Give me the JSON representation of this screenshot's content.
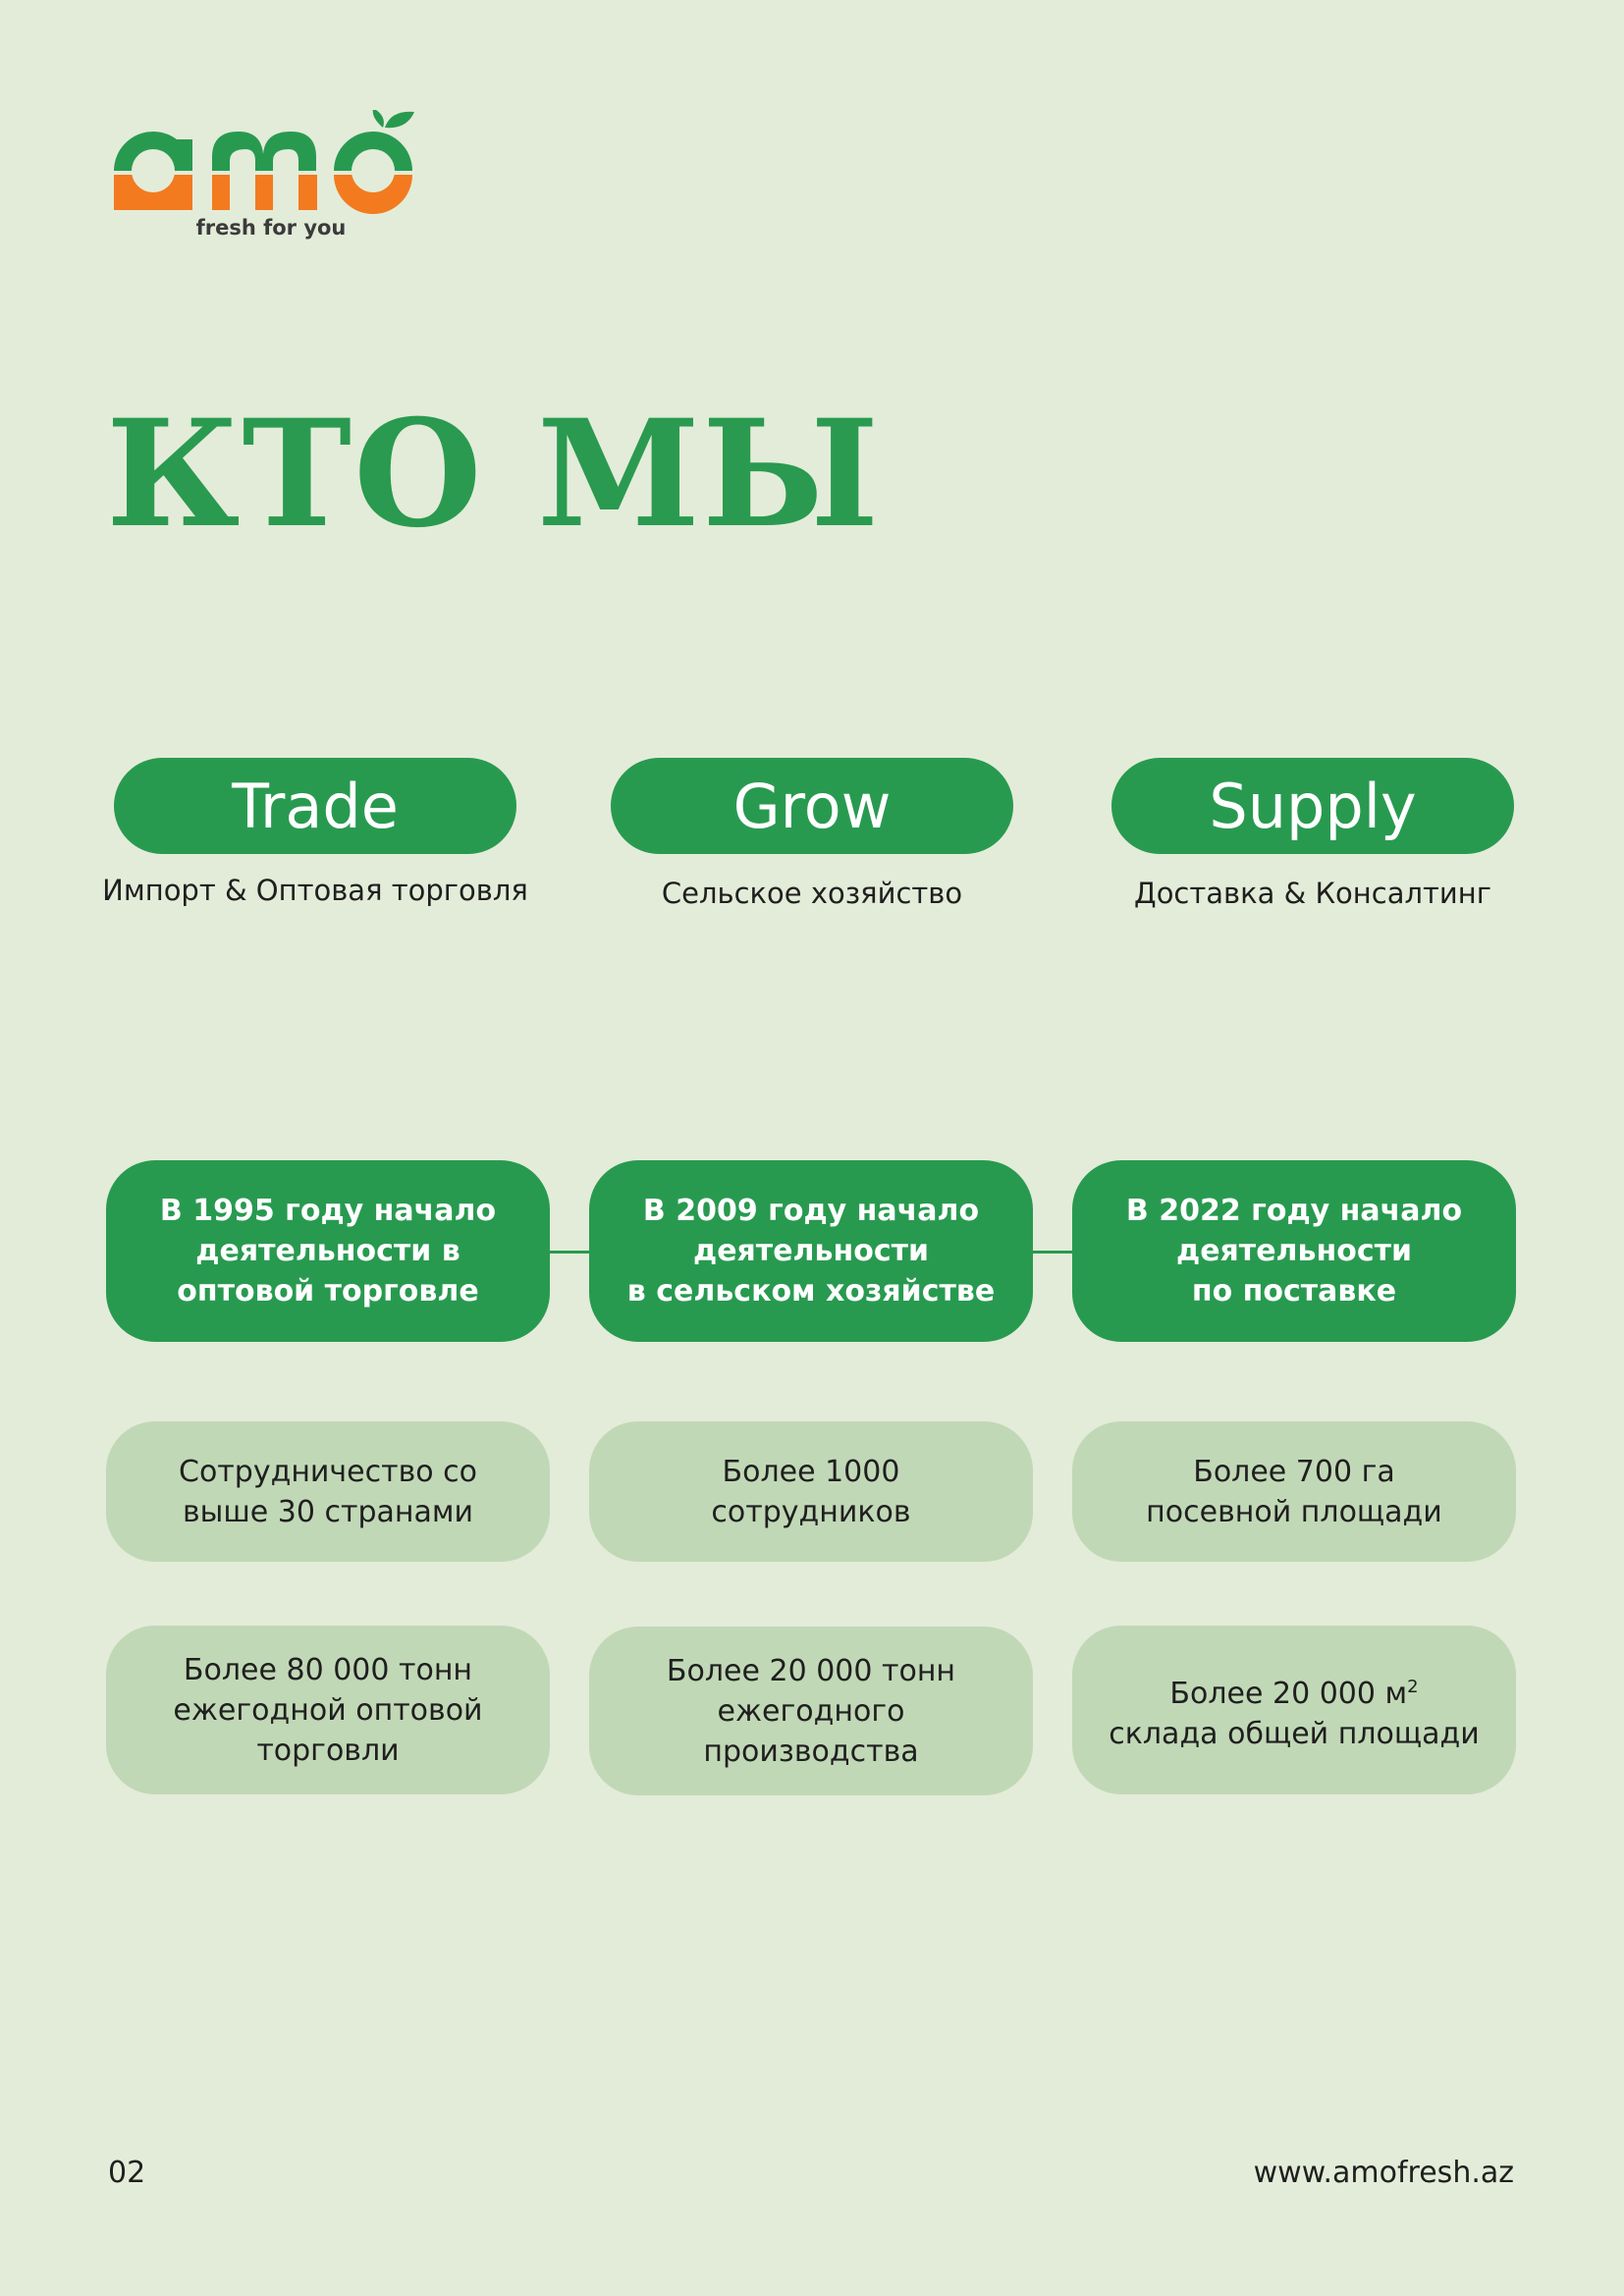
{
  "logo": {
    "wordmark": "amo",
    "tagline": "fresh for you"
  },
  "title": "КТО МЫ",
  "pillars": [
    {
      "label": "Trade",
      "subtitle": "Импорт & Оптовая торговля"
    },
    {
      "label": "Grow",
      "subtitle": "Сельское хозяйство"
    },
    {
      "label": "Supply",
      "subtitle": "Доставка & Консалтинг"
    }
  ],
  "milestones": [
    "В 1995 году начало\nдеятельности в\nоптовой торговле",
    "В 2009 году начало\nдеятельности\nв сельском хозяйстве",
    "В 2022 году начало\nдеятельности\nпо поставке"
  ],
  "facts_row1": [
    "Сотрудничество со\nвыше 30 странами",
    "Более 1000\nсотрудников",
    "Более 700 га\nпосевной площади"
  ],
  "facts_row2": [
    "Более 80 000 тонн\nежегодной оптовой\nторговли",
    "Более 20 000 тонн\nежегодного производства",
    {
      "line1": "Более 20 000 м",
      "sup": "2",
      "line2": "склада общей площади"
    }
  ],
  "footer": {
    "page_number": "02",
    "website": "www.amofresh.az"
  },
  "colors": {
    "background": "#e3ecd8",
    "green": "#289a50",
    "orange": "#f37a1f",
    "light_card": "#c1d8b6"
  }
}
